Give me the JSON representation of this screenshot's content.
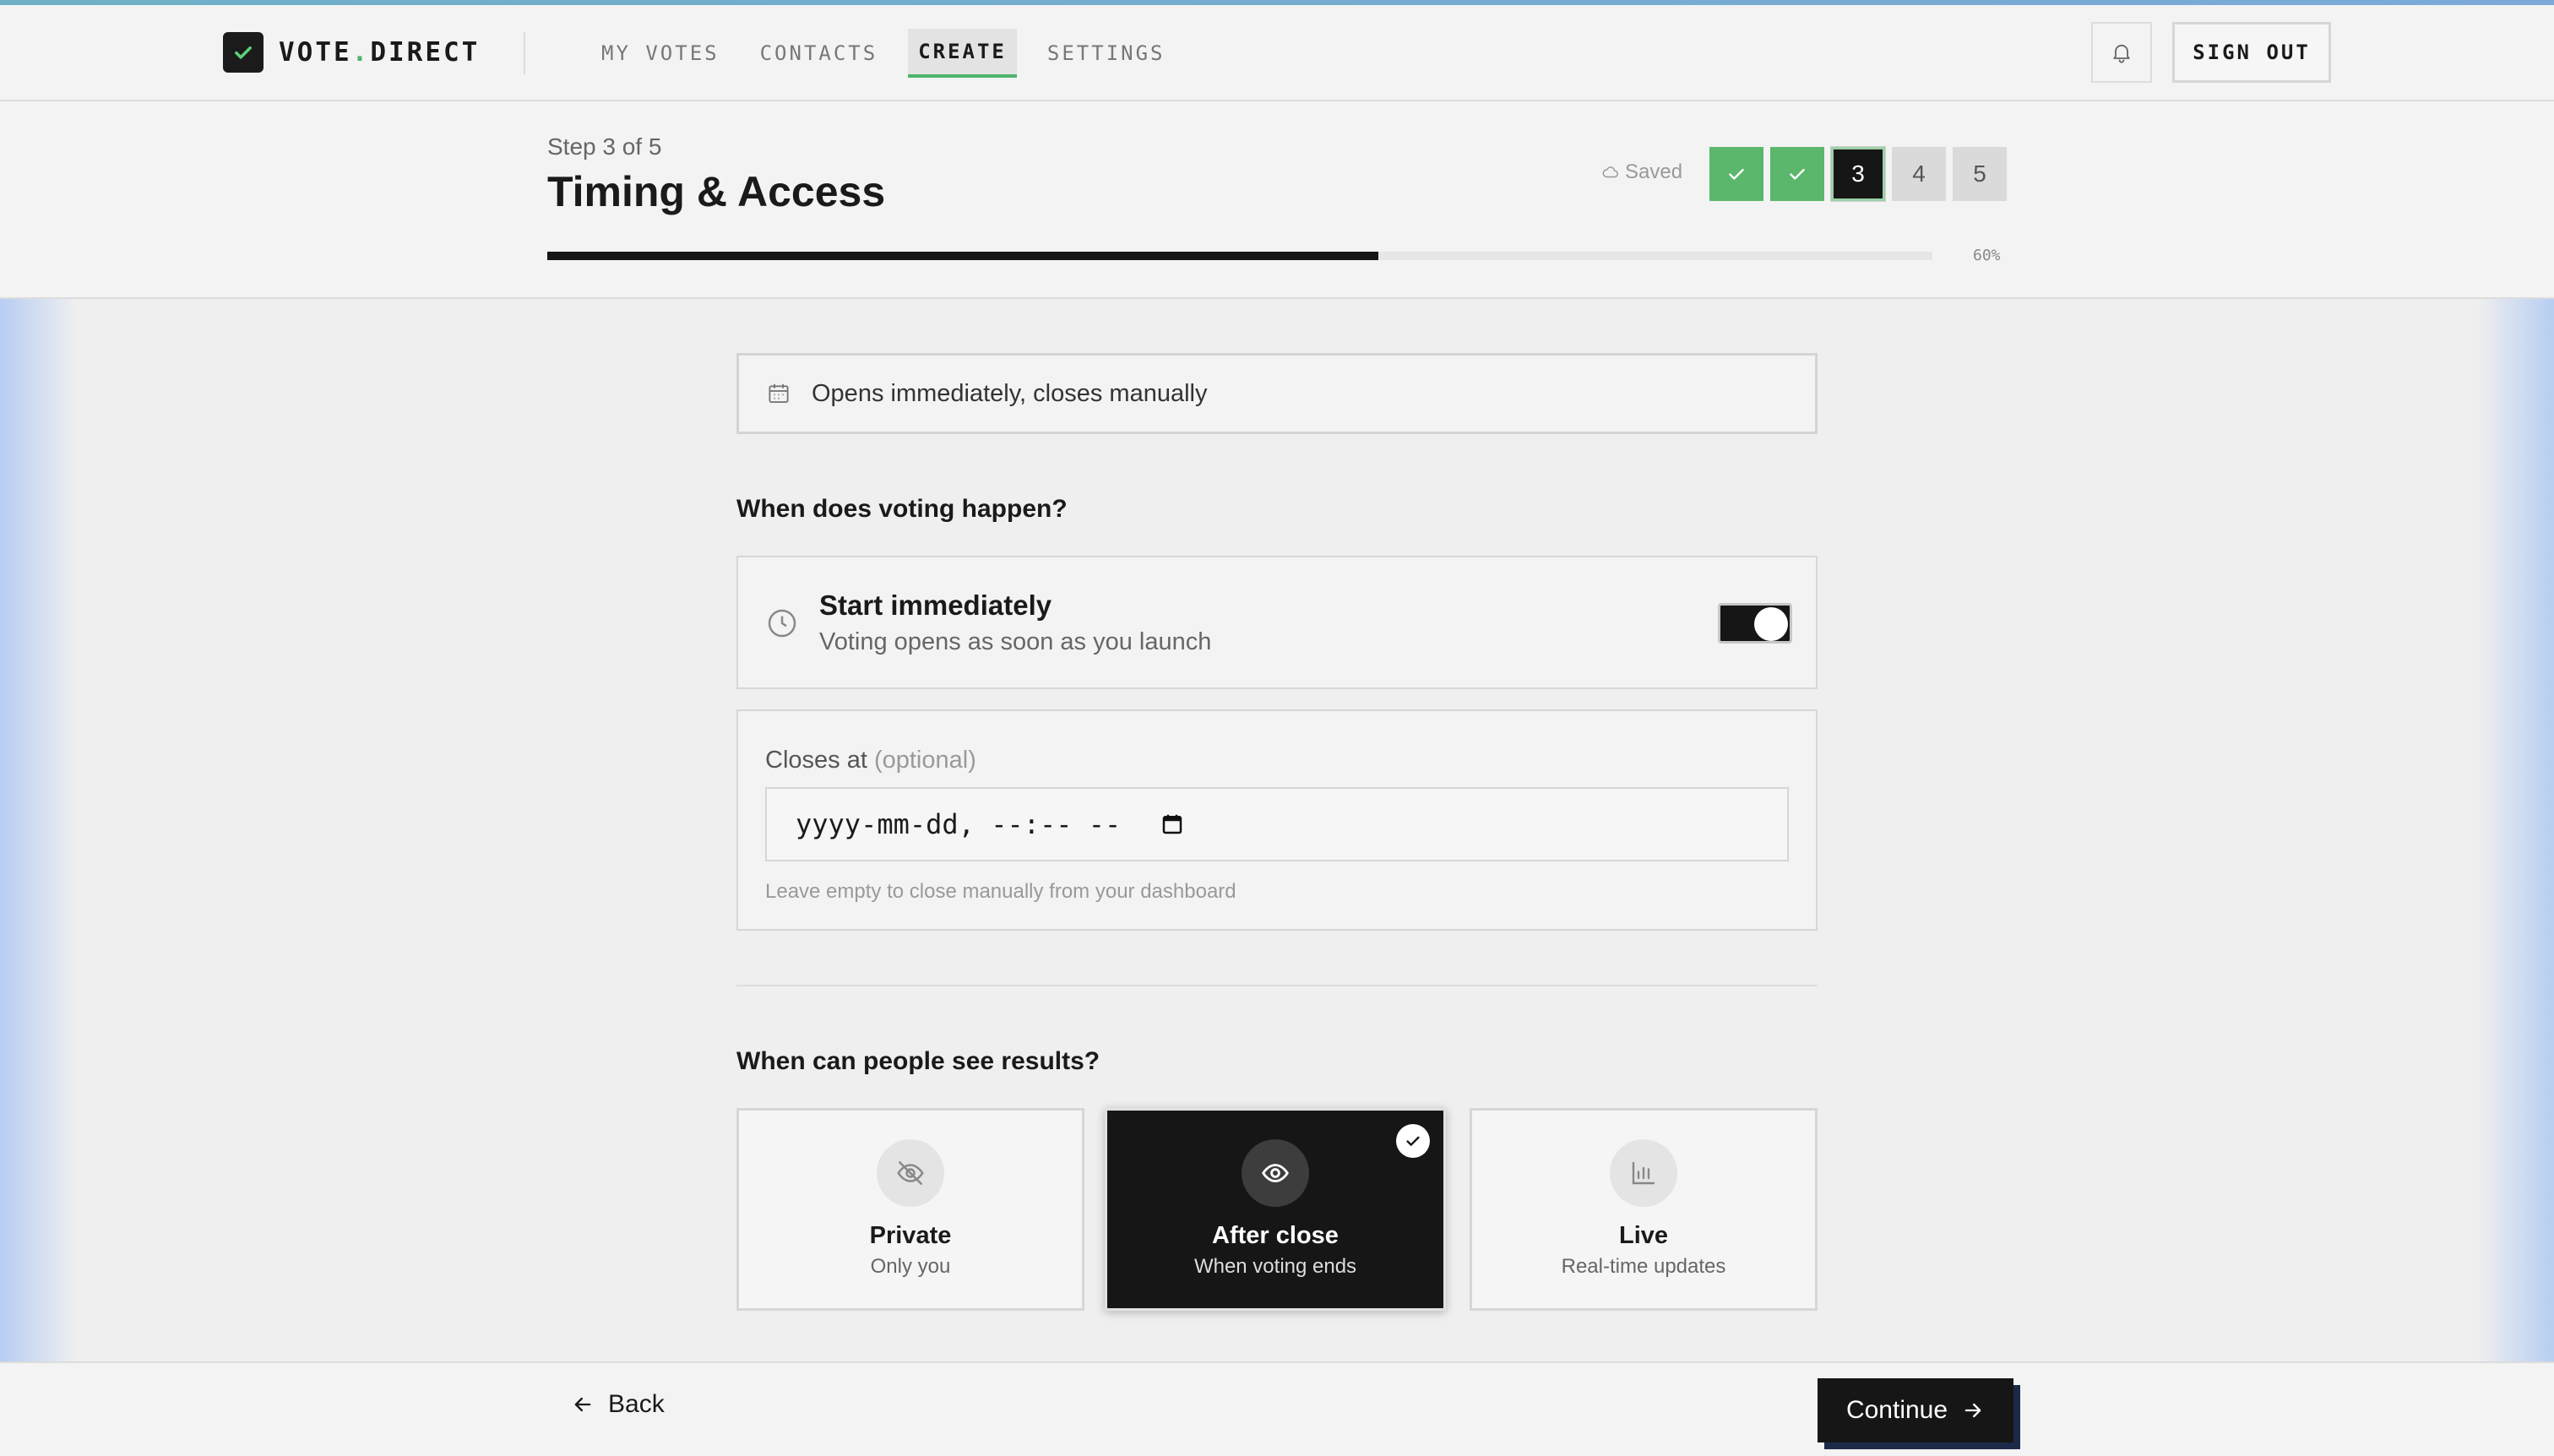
{
  "brand": {
    "name_part1": "VOTE",
    "name_dot": ".",
    "name_part2": "DIRECT",
    "accent": "#4fb46a"
  },
  "nav": {
    "items": [
      {
        "label": "MY VOTES",
        "active": false
      },
      {
        "label": "CONTACTS",
        "active": false
      },
      {
        "label": "CREATE",
        "active": true
      },
      {
        "label": "SETTINGS",
        "active": false
      }
    ],
    "bell_icon": "bell-icon",
    "sign_out_label": "SIGN OUT"
  },
  "wizard": {
    "step_label": "Step 3 of 5",
    "title": "Timing & Access",
    "saved_label": "Saved",
    "steps": [
      {
        "label": "",
        "state": "done"
      },
      {
        "label": "",
        "state": "done"
      },
      {
        "label": "3",
        "state": "current"
      },
      {
        "label": "4",
        "state": "upcoming"
      },
      {
        "label": "5",
        "state": "upcoming"
      }
    ],
    "progress_percent": 60,
    "progress_label": "60%"
  },
  "summary": {
    "text": "Opens immediately, closes manually",
    "icon": "calendar-icon"
  },
  "timing": {
    "question": "When does voting happen?",
    "start": {
      "title": "Start immediately",
      "subtitle": "Voting opens as soon as you launch",
      "toggle_on": true
    },
    "closes": {
      "label": "Closes at",
      "optional": "(optional)",
      "placeholder": "yyyy-mm-dd, --:-- --",
      "hint": "Leave empty to close manually from your dashboard"
    }
  },
  "results": {
    "question": "When can people see results?",
    "options": [
      {
        "title": "Private",
        "subtitle": "Only you",
        "icon": "eye-off-icon",
        "selected": false
      },
      {
        "title": "After close",
        "subtitle": "When voting ends",
        "icon": "eye-icon",
        "selected": true
      },
      {
        "title": "Live",
        "subtitle": "Real-time updates",
        "icon": "bar-chart-icon",
        "selected": false
      }
    ]
  },
  "footer": {
    "back_label": "Back",
    "continue_label": "Continue"
  }
}
